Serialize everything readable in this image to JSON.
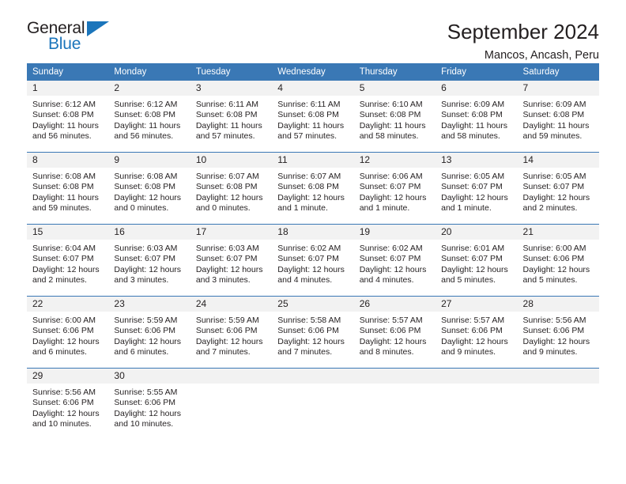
{
  "brand": {
    "name_top": "General",
    "name_bottom": "Blue",
    "triangle_color": "#1b75bb"
  },
  "header": {
    "title": "September 2024",
    "subtitle": "Mancos, Ancash, Peru"
  },
  "theme": {
    "header_blue": "#3a78b5",
    "daynum_bg": "#f2f2f2",
    "text": "#231f20"
  },
  "calendar": {
    "weekday_headers": [
      "Sunday",
      "Monday",
      "Tuesday",
      "Wednesday",
      "Thursday",
      "Friday",
      "Saturday"
    ],
    "weeks": [
      [
        {
          "day": "1",
          "sunrise": "Sunrise: 6:12 AM",
          "sunset": "Sunset: 6:08 PM",
          "daylight_1": "Daylight: 11 hours",
          "daylight_2": "and 56 minutes."
        },
        {
          "day": "2",
          "sunrise": "Sunrise: 6:12 AM",
          "sunset": "Sunset: 6:08 PM",
          "daylight_1": "Daylight: 11 hours",
          "daylight_2": "and 56 minutes."
        },
        {
          "day": "3",
          "sunrise": "Sunrise: 6:11 AM",
          "sunset": "Sunset: 6:08 PM",
          "daylight_1": "Daylight: 11 hours",
          "daylight_2": "and 57 minutes."
        },
        {
          "day": "4",
          "sunrise": "Sunrise: 6:11 AM",
          "sunset": "Sunset: 6:08 PM",
          "daylight_1": "Daylight: 11 hours",
          "daylight_2": "and 57 minutes."
        },
        {
          "day": "5",
          "sunrise": "Sunrise: 6:10 AM",
          "sunset": "Sunset: 6:08 PM",
          "daylight_1": "Daylight: 11 hours",
          "daylight_2": "and 58 minutes."
        },
        {
          "day": "6",
          "sunrise": "Sunrise: 6:09 AM",
          "sunset": "Sunset: 6:08 PM",
          "daylight_1": "Daylight: 11 hours",
          "daylight_2": "and 58 minutes."
        },
        {
          "day": "7",
          "sunrise": "Sunrise: 6:09 AM",
          "sunset": "Sunset: 6:08 PM",
          "daylight_1": "Daylight: 11 hours",
          "daylight_2": "and 59 minutes."
        }
      ],
      [
        {
          "day": "8",
          "sunrise": "Sunrise: 6:08 AM",
          "sunset": "Sunset: 6:08 PM",
          "daylight_1": "Daylight: 11 hours",
          "daylight_2": "and 59 minutes."
        },
        {
          "day": "9",
          "sunrise": "Sunrise: 6:08 AM",
          "sunset": "Sunset: 6:08 PM",
          "daylight_1": "Daylight: 12 hours",
          "daylight_2": "and 0 minutes."
        },
        {
          "day": "10",
          "sunrise": "Sunrise: 6:07 AM",
          "sunset": "Sunset: 6:08 PM",
          "daylight_1": "Daylight: 12 hours",
          "daylight_2": "and 0 minutes."
        },
        {
          "day": "11",
          "sunrise": "Sunrise: 6:07 AM",
          "sunset": "Sunset: 6:08 PM",
          "daylight_1": "Daylight: 12 hours",
          "daylight_2": "and 1 minute."
        },
        {
          "day": "12",
          "sunrise": "Sunrise: 6:06 AM",
          "sunset": "Sunset: 6:07 PM",
          "daylight_1": "Daylight: 12 hours",
          "daylight_2": "and 1 minute."
        },
        {
          "day": "13",
          "sunrise": "Sunrise: 6:05 AM",
          "sunset": "Sunset: 6:07 PM",
          "daylight_1": "Daylight: 12 hours",
          "daylight_2": "and 1 minute."
        },
        {
          "day": "14",
          "sunrise": "Sunrise: 6:05 AM",
          "sunset": "Sunset: 6:07 PM",
          "daylight_1": "Daylight: 12 hours",
          "daylight_2": "and 2 minutes."
        }
      ],
      [
        {
          "day": "15",
          "sunrise": "Sunrise: 6:04 AM",
          "sunset": "Sunset: 6:07 PM",
          "daylight_1": "Daylight: 12 hours",
          "daylight_2": "and 2 minutes."
        },
        {
          "day": "16",
          "sunrise": "Sunrise: 6:03 AM",
          "sunset": "Sunset: 6:07 PM",
          "daylight_1": "Daylight: 12 hours",
          "daylight_2": "and 3 minutes."
        },
        {
          "day": "17",
          "sunrise": "Sunrise: 6:03 AM",
          "sunset": "Sunset: 6:07 PM",
          "daylight_1": "Daylight: 12 hours",
          "daylight_2": "and 3 minutes."
        },
        {
          "day": "18",
          "sunrise": "Sunrise: 6:02 AM",
          "sunset": "Sunset: 6:07 PM",
          "daylight_1": "Daylight: 12 hours",
          "daylight_2": "and 4 minutes."
        },
        {
          "day": "19",
          "sunrise": "Sunrise: 6:02 AM",
          "sunset": "Sunset: 6:07 PM",
          "daylight_1": "Daylight: 12 hours",
          "daylight_2": "and 4 minutes."
        },
        {
          "day": "20",
          "sunrise": "Sunrise: 6:01 AM",
          "sunset": "Sunset: 6:07 PM",
          "daylight_1": "Daylight: 12 hours",
          "daylight_2": "and 5 minutes."
        },
        {
          "day": "21",
          "sunrise": "Sunrise: 6:00 AM",
          "sunset": "Sunset: 6:06 PM",
          "daylight_1": "Daylight: 12 hours",
          "daylight_2": "and 5 minutes."
        }
      ],
      [
        {
          "day": "22",
          "sunrise": "Sunrise: 6:00 AM",
          "sunset": "Sunset: 6:06 PM",
          "daylight_1": "Daylight: 12 hours",
          "daylight_2": "and 6 minutes."
        },
        {
          "day": "23",
          "sunrise": "Sunrise: 5:59 AM",
          "sunset": "Sunset: 6:06 PM",
          "daylight_1": "Daylight: 12 hours",
          "daylight_2": "and 6 minutes."
        },
        {
          "day": "24",
          "sunrise": "Sunrise: 5:59 AM",
          "sunset": "Sunset: 6:06 PM",
          "daylight_1": "Daylight: 12 hours",
          "daylight_2": "and 7 minutes."
        },
        {
          "day": "25",
          "sunrise": "Sunrise: 5:58 AM",
          "sunset": "Sunset: 6:06 PM",
          "daylight_1": "Daylight: 12 hours",
          "daylight_2": "and 7 minutes."
        },
        {
          "day": "26",
          "sunrise": "Sunrise: 5:57 AM",
          "sunset": "Sunset: 6:06 PM",
          "daylight_1": "Daylight: 12 hours",
          "daylight_2": "and 8 minutes."
        },
        {
          "day": "27",
          "sunrise": "Sunrise: 5:57 AM",
          "sunset": "Sunset: 6:06 PM",
          "daylight_1": "Daylight: 12 hours",
          "daylight_2": "and 9 minutes."
        },
        {
          "day": "28",
          "sunrise": "Sunrise: 5:56 AM",
          "sunset": "Sunset: 6:06 PM",
          "daylight_1": "Daylight: 12 hours",
          "daylight_2": "and 9 minutes."
        }
      ],
      [
        {
          "day": "29",
          "sunrise": "Sunrise: 5:56 AM",
          "sunset": "Sunset: 6:06 PM",
          "daylight_1": "Daylight: 12 hours",
          "daylight_2": "and 10 minutes."
        },
        {
          "day": "30",
          "sunrise": "Sunrise: 5:55 AM",
          "sunset": "Sunset: 6:06 PM",
          "daylight_1": "Daylight: 12 hours",
          "daylight_2": "and 10 minutes."
        },
        {
          "day": "",
          "sunrise": "",
          "sunset": "",
          "daylight_1": "",
          "daylight_2": ""
        },
        {
          "day": "",
          "sunrise": "",
          "sunset": "",
          "daylight_1": "",
          "daylight_2": ""
        },
        {
          "day": "",
          "sunrise": "",
          "sunset": "",
          "daylight_1": "",
          "daylight_2": ""
        },
        {
          "day": "",
          "sunrise": "",
          "sunset": "",
          "daylight_1": "",
          "daylight_2": ""
        },
        {
          "day": "",
          "sunrise": "",
          "sunset": "",
          "daylight_1": "",
          "daylight_2": ""
        }
      ]
    ]
  }
}
